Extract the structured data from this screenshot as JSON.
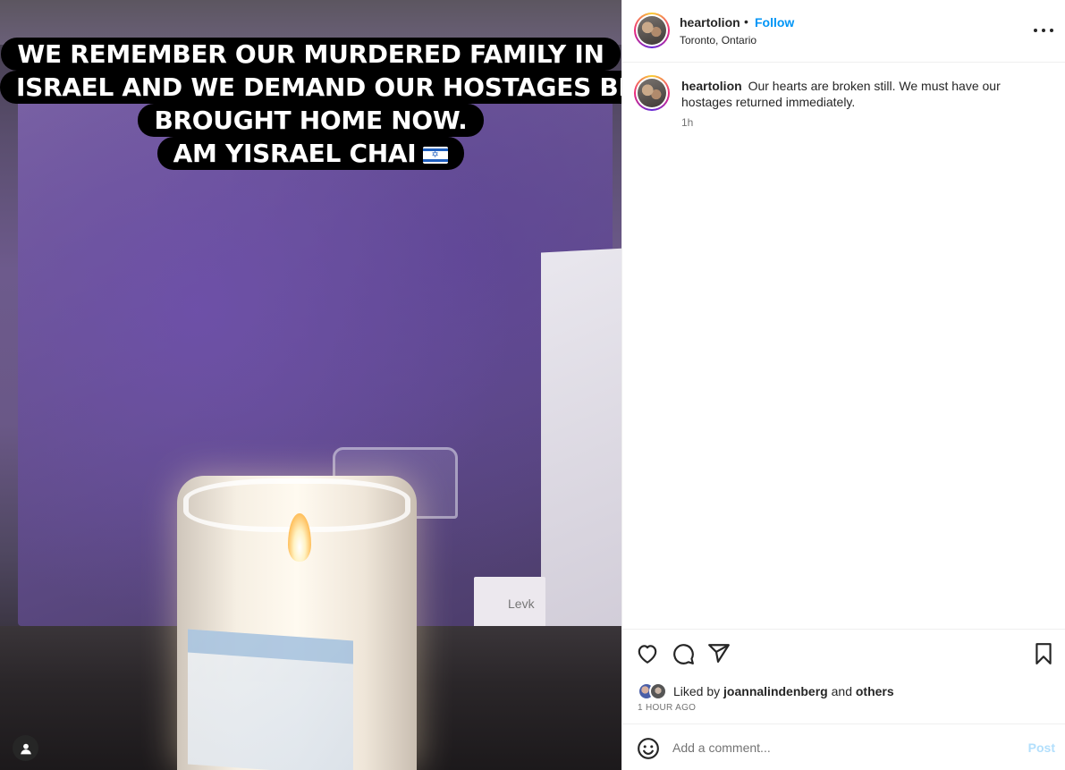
{
  "story": {
    "caption_lines": [
      "WE REMEMBER OUR MURDERED FAMILY IN",
      "ISRAEL AND WE DEMAND OUR HOSTAGES BE",
      "BROUGHT HOME NOW.",
      "AM YISRAEL CHAI"
    ],
    "flag_icon": "israel-flag-emoji",
    "artwork_label": "Levk"
  },
  "header": {
    "username": "heartolion",
    "separator": "•",
    "follow_label": "Follow",
    "location": "Toronto, Ontario",
    "more_icon": "ellipsis-icon"
  },
  "caption": {
    "username": "heartolion",
    "text": "Our hearts are broken still. We must have our hostages returned immediately.",
    "time": "1h"
  },
  "actions": {
    "icons": [
      "heart-icon",
      "comment-bubble-icon",
      "paper-plane-icon",
      "bookmark-icon"
    ],
    "liked_prefix": "Liked by",
    "liked_user": "joannalindenberg",
    "liked_and": "and",
    "liked_others": "others",
    "post_time": "1 HOUR AGO"
  },
  "comment_box": {
    "placeholder": "Add a comment...",
    "post_label": "Post"
  },
  "colors": {
    "accent": "#0095f6",
    "post_disabled": "#b2dffc",
    "text": "#262626",
    "muted": "#737373"
  }
}
